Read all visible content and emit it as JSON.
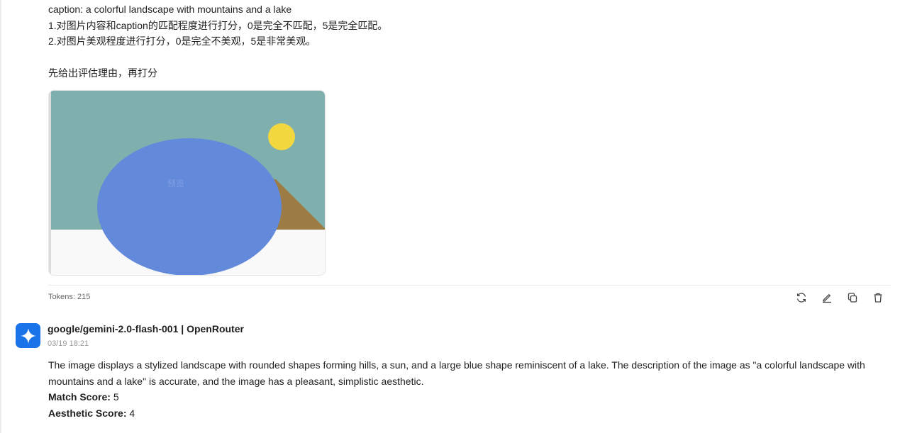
{
  "user_message": {
    "lines": [
      "caption: a colorful landscape with mountains and a lake",
      "1.对图片内容和caption的匹配程度进行打分，0是完全不匹配，5是完全匹配。",
      "2.对图片美观程度进行打分，0是完全不美观，5是非常美观。",
      "",
      "先给出评估理由，再打分"
    ],
    "image_overlay_text": "预览",
    "tokens": "Tokens: 215"
  },
  "image_colors": {
    "sky": "#80b0ae",
    "sun": "#f2d83e",
    "hill": "#9c7c44",
    "lake": "#6289da",
    "ground": "#f9f9f9"
  },
  "actions": [
    {
      "name": "regenerate-icon"
    },
    {
      "name": "edit-icon"
    },
    {
      "name": "copy-icon"
    },
    {
      "name": "delete-icon"
    }
  ],
  "assistant": {
    "model": "google/gemini-2.0-flash-001 | OpenRouter",
    "timestamp": "03/19 18:21",
    "avatar_icon": "gemini-sparkle-icon",
    "body": "The image displays a stylized landscape with rounded shapes forming hills, a sun, and a large blue shape reminiscent of a lake. The description of the image as \"a colorful landscape with mountains and a lake\" is accurate, and the image has a pleasant, simplistic aesthetic.",
    "scores": [
      {
        "label": "Match Score:",
        "value": "5"
      },
      {
        "label": "Aesthetic Score:",
        "value": "4"
      }
    ]
  }
}
